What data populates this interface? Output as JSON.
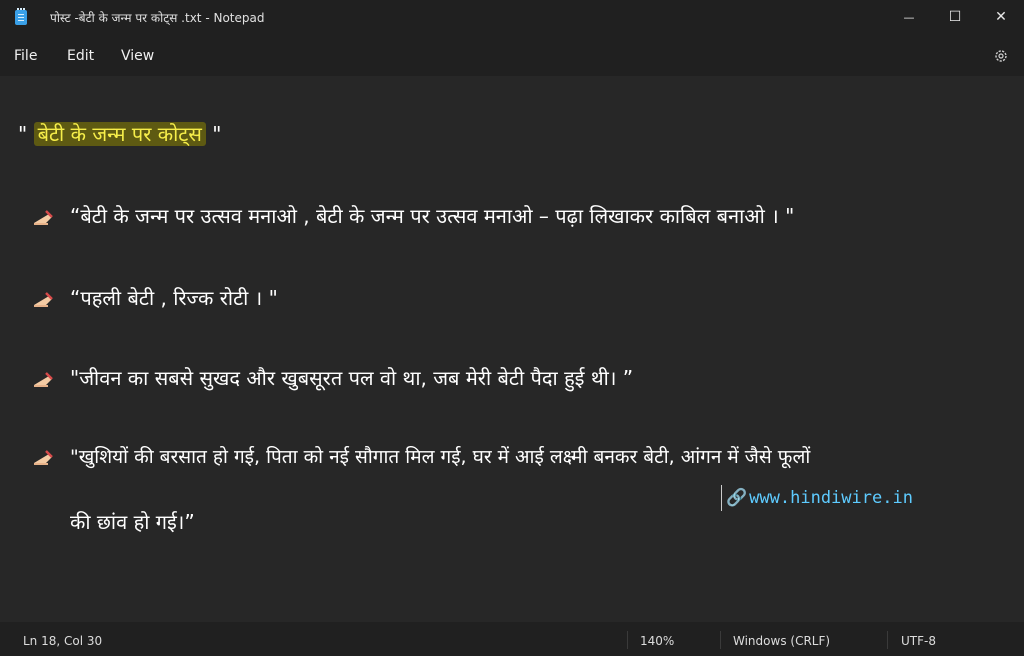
{
  "window": {
    "title": "पोस्ट -बेटी के जन्म पर कोट्स .txt - Notepad",
    "minimize_glyph": "—",
    "maximize_glyph": "☐",
    "close_glyph": "✕"
  },
  "menu": {
    "file": "File",
    "edit": "Edit",
    "view": "View",
    "settings_icon": "gear-icon"
  },
  "document": {
    "heading_open": "\" ",
    "heading_highlight": "बेटी के जन्म पर कोट्स",
    "heading_close": " \"",
    "quotes": [
      {
        "text": "“बेटी के जन्म पर उत्सव मनाओ ,  बेटी के जन्म पर उत्सव मनाओ – पढ़ा लिखाकर काबिल बनाओ । \""
      },
      {
        "text": "“पहली बेटी ,  रिज्क रोटी । \""
      },
      {
        "text": "\"जीवन का सबसे सुखद और खुबसूरत पल वो था,  जब मेरी बेटी पैदा हुई थी। ”"
      },
      {
        "text": "\"खुशियों की बरसात हो गई,  पिता को नई सौगात मिल गई,  घर में आई लक्ष्मी बनकर बेटी,  आंगन में जैसे फूलों"
      }
    ],
    "continuation": "की छांव हो गई।”",
    "link_icon": "🔗",
    "link_text": "www.hindiwire.in"
  },
  "status": {
    "position": "Ln 18, Col 30",
    "zoom": "140%",
    "line_ending": "Windows (CRLF)",
    "encoding": "UTF-8"
  },
  "colors": {
    "highlight_bg": "#5e5a12",
    "highlight_text": "#f6ee4a",
    "link": "#5ecbff"
  }
}
